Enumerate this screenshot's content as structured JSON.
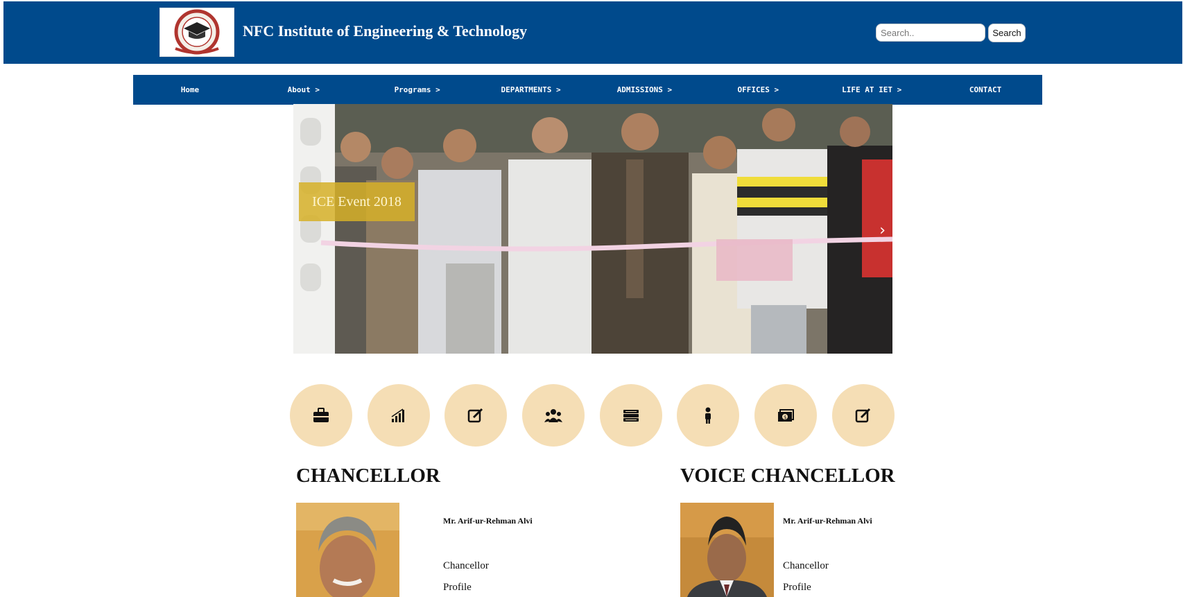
{
  "header": {
    "site_title": "NFC Institute of Engineering & Technology",
    "search_placeholder": "Search..",
    "search_button_label": "Search",
    "background_color": "#004a8c"
  },
  "nav": {
    "items": [
      {
        "label": "Home"
      },
      {
        "label": "About >"
      },
      {
        "label": "Programs >"
      },
      {
        "label": "DEPARTMENTS >"
      },
      {
        "label": "ADMISSIONS >"
      },
      {
        "label": "OFFICES >"
      },
      {
        "label": "LIFE AT IET >"
      },
      {
        "label": "CONTACT"
      }
    ]
  },
  "slider": {
    "caption": "ICE Event 2018",
    "next_arrow": "›",
    "caption_color": "#d6b028"
  },
  "quick_links": {
    "icons": [
      "briefcase-icon",
      "bar-chart-icon",
      "edit-icon",
      "users-icon",
      "books-icon",
      "person-icon",
      "money-icon",
      "edit-icon"
    ],
    "circle_color": "#f5deb5"
  },
  "chancellor": {
    "heading": "CHANCELLOR",
    "name": "Mr. Arif-ur-Rehman Alvi",
    "role": "Chancellor",
    "profile": "Profile"
  },
  "vice_chancellor": {
    "heading": "VOICE CHANCELLOR",
    "name": "Mr. Arif-ur-Rehman Alvi",
    "role": "Chancellor",
    "profile": "Profile"
  }
}
